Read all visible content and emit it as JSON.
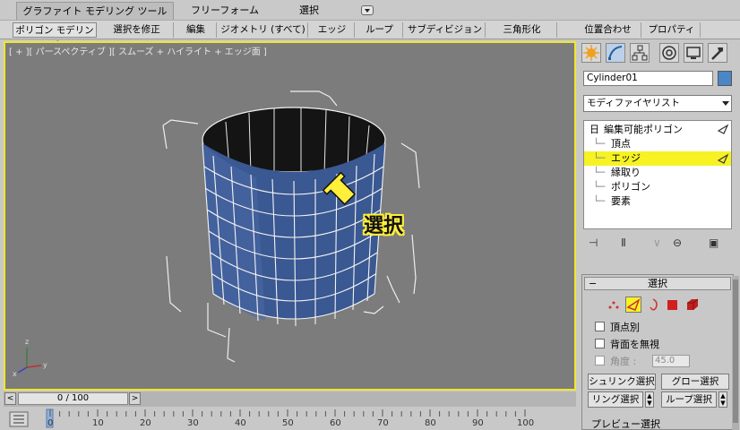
{
  "ribbon": {
    "tabs": [
      "グラファイト モデリング ツール",
      "フリーフォーム",
      "選択"
    ],
    "toolbar": [
      "ポリゴン モデリング",
      "選択を修正",
      "編集",
      "ジオメトリ (すべて)",
      "エッジ",
      "ループ",
      "サブディビジョン",
      "三角形化",
      "位置合わせ",
      "プロパティ"
    ]
  },
  "viewport": {
    "label": "[ + ][ パースペクティブ ][ スムーズ + ハイライト + エッジ面 ]",
    "annotation": "選択",
    "axes": {
      "x": "x",
      "y": "y",
      "z": "z"
    },
    "colors": {
      "border": "#f2e62b",
      "background": "#7c7c7c",
      "mesh": "#2f4f8f",
      "annotation": "#ffef3a"
    }
  },
  "command_panel": {
    "object_name": "Cylinder01",
    "object_color": "#4b86c7",
    "modifier_list": "モディファイヤリスト",
    "stack": {
      "root": "編集可能ポリゴン",
      "items": [
        "頂点",
        "エッジ",
        "縁取り",
        "ポリゴン",
        "要素"
      ],
      "selected": "エッジ",
      "collapse_symbol": "日"
    },
    "selection_rollout": {
      "title": "選択",
      "collapse": "−",
      "checkboxes": [
        "頂点別",
        "背面を無視"
      ],
      "angle_label": "角度 :",
      "angle_value": "45.0",
      "buttons": [
        "シュリンク選択",
        "グロー選択",
        "リング選択",
        "ループ選択"
      ],
      "preview_label": "プレビュー選択"
    }
  },
  "timeline": {
    "slider": "0 / 100",
    "prev": "<",
    "next": ">",
    "ruler": [
      "0",
      "10",
      "20",
      "30",
      "40",
      "50",
      "60",
      "70",
      "80",
      "90",
      "100"
    ]
  }
}
